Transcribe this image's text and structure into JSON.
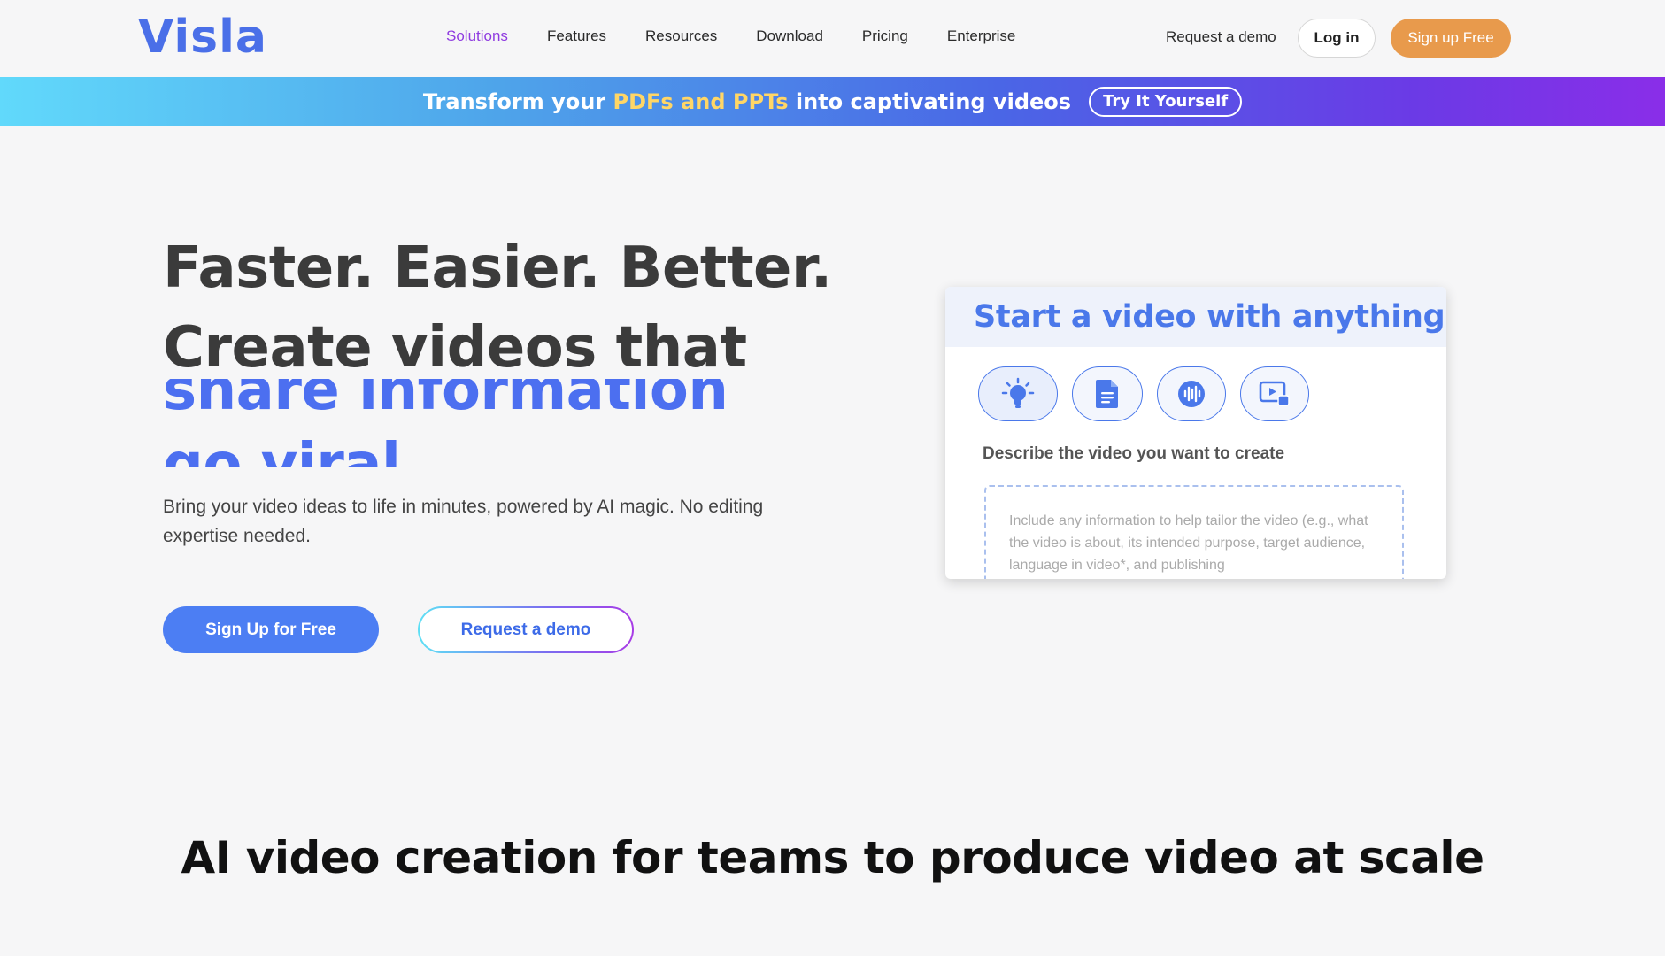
{
  "nav": {
    "logo": "Visla",
    "items": [
      {
        "label": "Solutions",
        "active": true
      },
      {
        "label": "Features"
      },
      {
        "label": "Resources"
      },
      {
        "label": "Download"
      },
      {
        "label": "Pricing"
      },
      {
        "label": "Enterprise"
      }
    ],
    "request_demo": "Request a demo",
    "login": "Log in",
    "signup": "Sign up Free"
  },
  "banner": {
    "text_before": "Transform your ",
    "highlight": "PDFs and PPTs",
    "text_after": " into captivating videos",
    "button": "Try It Yourself"
  },
  "hero": {
    "line1": "Faster. Easier. Better.",
    "line2": "Create videos that",
    "rotating_words": [
      "share information",
      "go viral"
    ],
    "subtitle": "Bring your video ideas to life in minutes, powered by AI magic. No editing expertise needed.",
    "cta_primary": "Sign Up for Free",
    "cta_secondary": "Request a demo"
  },
  "card": {
    "title": "Start a video with anything",
    "modes": [
      {
        "icon": "lightbulb-icon",
        "active": true
      },
      {
        "icon": "document-icon"
      },
      {
        "icon": "audio-wave-icon"
      },
      {
        "icon": "video-icon"
      }
    ],
    "label": "Describe the video you want to create",
    "placeholder": "Include any information to help tailor the video (e.g., what the video is about,  its intended purpose, target audience, language in video*, and publishing"
  },
  "section": {
    "title": "AI video creation for teams to produce video at scale"
  },
  "colors": {
    "brand": "#4a6fe8",
    "accent_orange": "#e89a4c",
    "active_nav": "#8f3be0",
    "primary_button": "#4c7ef3"
  }
}
